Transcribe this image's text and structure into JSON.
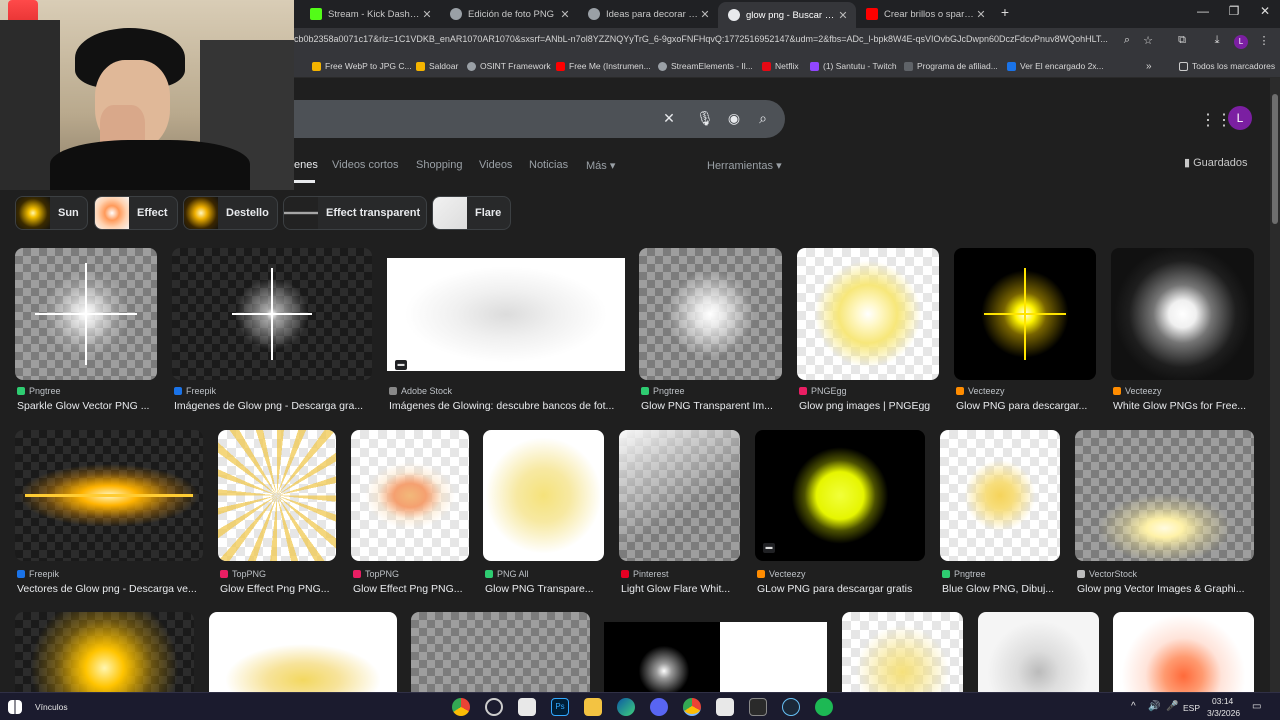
{
  "browser": {
    "tabs": [
      {
        "label": "Stream - Kick Dashboard",
        "color": "#53fc18"
      },
      {
        "label": "Edición de foto PNG",
        "color": "#9aa0a6"
      },
      {
        "label": "Ideas para decorar flyer",
        "color": "#9aa0a6"
      },
      {
        "label": "glow png - Buscar con Google",
        "color": "#9aa0a6"
      },
      {
        "label": "Crear brillos o sparkles - YouTube",
        "color": "#ff0000"
      }
    ],
    "new_tab": "+",
    "url": "cb0b2358a0071c17&rlz=1C1VDKB_enAR1070AR1070&sxsrf=ANbL-n7ol8YZZNQYyTrG_6-9gxoFNFHqvQ:1772516952147&udm=2&fbs=ADc_l-bpk8W4E-qsVIOvbGJcDwpn60DczFdcvPnuv8WQohHLT...",
    "profile_letter": "L",
    "bookmarks": [
      "Free WebP to JPG C...",
      "Saldoar",
      "OSINT Framework",
      "Free Me (Instrumen...",
      "StreamElements - Il...",
      "Netflix",
      "(1) Santutu - Twitch",
      "Programa de afiliad...",
      "Ver El encargado 2x..."
    ],
    "all_bookmarks": "Todos los marcadores"
  },
  "google": {
    "avatar_letter": "L",
    "tabs": [
      "enes",
      "Videos cortos",
      "Shopping",
      "Videos",
      "Noticias",
      "Más ▾"
    ],
    "tools": "Herramientas ▾",
    "saved": "Guardados",
    "chips": [
      "Sun",
      "Effect",
      "Destello",
      "Effect transparent",
      "Flare"
    ],
    "results": [
      {
        "source": "Pngtree",
        "title": "Sparkle Glow Vector PNG ...",
        "favcolor": "#2ecc71"
      },
      {
        "source": "Freepik",
        "title": "Imágenes de Glow png - Descarga gra...",
        "favcolor": "#1a73e8"
      },
      {
        "source": "Adobe Stock",
        "title": "Imágenes de Glowing: descubre bancos de fot...",
        "favcolor": "#888888"
      },
      {
        "source": "Pngtree",
        "title": "Glow PNG Transparent Im...",
        "favcolor": "#2ecc71"
      },
      {
        "source": "PNGEgg",
        "title": "Glow png images | PNGEgg",
        "favcolor": "#e91e63"
      },
      {
        "source": "Vecteezy",
        "title": "Glow PNG para descargar...",
        "favcolor": "#ff8c00"
      },
      {
        "source": "Vecteezy",
        "title": "White Glow PNGs for Free...",
        "favcolor": "#ff8c00"
      },
      {
        "source": "Freepik",
        "title": "Vectores de Glow png - Descarga ve...",
        "favcolor": "#1a73e8"
      },
      {
        "source": "TopPNG",
        "title": "Glow Effect Png PNG...",
        "favcolor": "#e91e63"
      },
      {
        "source": "TopPNG",
        "title": "Glow Effect Png PNG...",
        "favcolor": "#e91e63"
      },
      {
        "source": "PNG All",
        "title": "Glow PNG Transpare...",
        "favcolor": "#2ecc71"
      },
      {
        "source": "Pinterest",
        "title": "Light Glow Flare Whit...",
        "favcolor": "#e60023"
      },
      {
        "source": "Vecteezy",
        "title": "GLow PNG para descargar gratis",
        "favcolor": "#ff8c00"
      },
      {
        "source": "Pngtree",
        "title": "Blue Glow PNG, Dibuj...",
        "favcolor": "#2ecc71"
      },
      {
        "source": "VectorStock",
        "title": "Glow png Vector Images & Graphi...",
        "favcolor": "#bbbbbb"
      }
    ]
  },
  "taskbar": {
    "links_label": "Vínculos",
    "lang": "ESP",
    "time": "03:14",
    "date": "3/3/2026"
  }
}
